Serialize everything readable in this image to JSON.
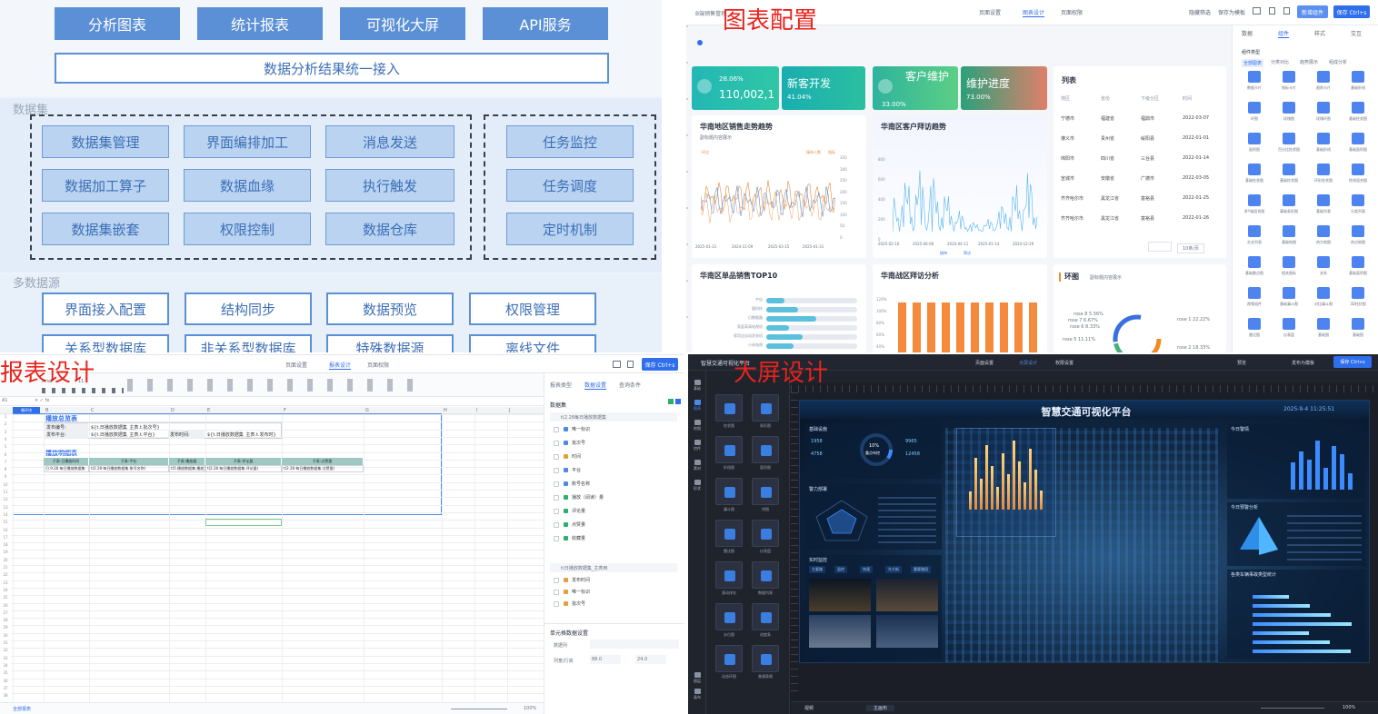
{
  "architecture": {
    "top_buttons": [
      "分析图表",
      "统计报表",
      "可视化大屏",
      "API服务"
    ],
    "unify_label": "数据分析结果统一接入",
    "dataset_section": "数据集",
    "dataset_cells": [
      [
        "数据集管理",
        "界面编排加工",
        "消息发送"
      ],
      [
        "数据加工算子",
        "数据血缘",
        "执行触发"
      ],
      [
        "数据集嵌套",
        "权限控制",
        "数据仓库"
      ]
    ],
    "task_cells": [
      "任务监控",
      "任务调度",
      "定时机制"
    ],
    "multi_source_section": "多数据源",
    "source_cells": [
      "界面接入配置",
      "结构同步",
      "数据预览",
      "权限管理"
    ],
    "source_cells_row2": [
      "关系型数据库",
      "非关系型数据库",
      "特殊数据源",
      "离线文件"
    ]
  },
  "chart_config": {
    "overlay_title": "图表配置",
    "app_name": "B端销售管理",
    "tabs": [
      "页面设置",
      "图表设计",
      "页面权限"
    ],
    "top_actions": [
      "隐藏筛选",
      "保存为模板"
    ],
    "add_component": "新增组件",
    "save": "保存 Ctrl+s",
    "kpis": [
      {
        "title": "",
        "value": "110,002,1",
        "pct": "28.06%",
        "color": "#26b8b0"
      },
      {
        "title": "新客开发",
        "value": "",
        "pct": "41.04%",
        "color": "#1fb6a9"
      },
      {
        "title": "客户维护",
        "value": "",
        "pct": "33.00%",
        "color": "#3fc08a"
      },
      {
        "title": "维护进度",
        "value": "",
        "pct": "73.00%",
        "color": "#e0806a"
      }
    ],
    "panel_titles": [
      "华南地区销售走势趋势",
      "华南区客户拜访趋势",
      "华南区单品销售TOP10",
      "华南战区拜访分析",
      "环图"
    ],
    "panel_subtitle_1": "副标题内容展示",
    "panel_subtitle_ring": "副标题内容展示",
    "trend_legend": [
      "接待人数",
      "指标"
    ],
    "trend_left_axis": "环比",
    "trend_dates": [
      "2025-01-31",
      "2024-11-09",
      "2025-03-15",
      "2025-01-31"
    ],
    "trend_yticks": [
      "350",
      "300",
      "250",
      "200",
      "150",
      "100",
      "50",
      "0"
    ],
    "visit_dates": [
      "2025-02-10",
      "2025-06-06",
      "2024-04-11",
      "2025-01-14",
      "2024-12-29"
    ],
    "visit_yticks": [
      "800",
      "600",
      "400",
      "200",
      "0"
    ],
    "visit_legend": [
      "接待",
      "拜访"
    ],
    "top10_labels": [
      "中出",
      "量科技",
      "日数据器",
      "家庭高清电视机",
      "家用全自动洗衣机",
      "小米电视"
    ],
    "visit_bar_yticks": [
      "120%",
      "100%",
      "80%",
      "60%",
      "40%"
    ],
    "ring_labels": [
      "rose 8 5.56%",
      "rose 7 6.67%",
      "rose 6 8.33%",
      "rose 5 11.11%",
      "rose 1 22.22%",
      "rose 2 18.33%"
    ],
    "list_title": "列表",
    "list_headers": [
      "地区",
      "省份",
      "下级分区",
      "时间"
    ],
    "list_rows": [
      [
        "宁德市",
        "福建省",
        "福鼎市",
        "2022-03-07"
      ],
      [
        "遵义市",
        "贵州省",
        "绥阳县",
        "2022-01-01"
      ],
      [
        "绵阳市",
        "四川省",
        "三台县",
        "2022-01-14"
      ],
      [
        "宣城市",
        "安徽省",
        "广德市",
        "2022-03-05"
      ],
      [
        "齐齐哈尔市",
        "黑龙江省",
        "富裕县",
        "2022-01-25"
      ],
      [
        "齐齐哈尔市",
        "黑龙江省",
        "富裕县",
        "2022-01-26"
      ]
    ],
    "pager": "10条/页",
    "right_tabs": [
      "数据",
      "组件",
      "样式",
      "交互"
    ],
    "component_type_label": "组件类型",
    "component_filters": [
      "全部图表",
      "分类对比",
      "趋势展示",
      "组成分析"
    ],
    "components": [
      "数据卡片",
      "指标卡片",
      "趋势卡片",
      "基础折线",
      "环图",
      "玫瑰图",
      "玫瑰环图",
      "基础柱状图",
      "面积图",
      "百分比柱状图",
      "基础折线",
      "基础面积图",
      "基础柱状图",
      "基础柱状图",
      "环形柱状图",
      "柱线混合图",
      "多Y轴混合图",
      "基础条形图",
      "基础列表",
      "分类列表",
      "交叉列表",
      "基础地图",
      "热力地图",
      "热点地图",
      "基础散点图",
      "相关图标",
      "关系",
      "基础面积图",
      "视频组件",
      "基础漏斗图",
      "对比漏斗图",
      "3D柱状图",
      "雷达图",
      "仪表盘",
      "基础图",
      "基础图"
    ]
  },
  "report_design": {
    "overlay_title": "报表设计",
    "tabs": [
      "页面设置",
      "报表设计",
      "页面权限"
    ],
    "save": "保存 Ctrl+s",
    "font": "Arial",
    "font_size": "11",
    "cell_ref": "A1",
    "columns": [
      "A",
      "B",
      "C",
      "D",
      "E",
      "F",
      "G",
      "H",
      "I",
      "J"
    ],
    "tag": "循环块",
    "summary_title": "播放总览表",
    "summary_rows": [
      [
        "发布编号:",
        "${t.日播放数据集_主表.t.批次号}"
      ],
      [
        "发布平台:",
        "${t.日播放数据集_主表.t.平台}",
        "发布时间:",
        "${t.日播放数据集_主表.t.发布时}"
      ]
    ],
    "detail_title": "播放明细表",
    "detail_headers": [
      "子表-日播放时间",
      "子表-平台",
      "子表-播放量",
      "子表-评论量",
      "子表-点赞量"
    ],
    "detail_row": [
      "日.9.28 每日播放数据集",
      "t(2.28 每日播放数据集.账号名称)",
      "t(5.播放数据集.播放)",
      "t(2.28 每日播放数据集.评论量)",
      "t(2.28 每日播放数据集.点赞量)"
    ],
    "side_tabs": [
      "报表类型",
      "数据设置",
      "查询条件"
    ],
    "dataset_label": "数据集",
    "dataset1": "t(2.28每日播放数据集",
    "dataset1_fields": [
      "唯一标识",
      "批次号",
      "时间",
      "平台",
      "账号名称",
      "播放（阅读）量",
      "评论量",
      "点赞量",
      "收藏量"
    ],
    "dataset2": "t(日播放数据集_主表用",
    "dataset2_fields": [
      "发布时间",
      "唯一标识",
      "批次号"
    ],
    "cell_settings": "单元格数据设置",
    "data_column": "数据列",
    "column_lbl": "列宽/行高",
    "col_width": "88.0",
    "row_height": "24.0",
    "sheet": "全部报表",
    "zoom": "100%"
  },
  "screen_design": {
    "overlay_title": "大屏设计",
    "app_name": "智慧交通可视化平台",
    "tabs": [
      "页面设置",
      "大屏设计",
      "权限设置"
    ],
    "top_actions": [
      "预览",
      "发布为模板"
    ],
    "save": "保存 Ctrl+s",
    "left_nav": [
      "基础",
      "图表",
      "地图",
      "控件",
      "素材",
      "形状",
      "图层",
      "画布"
    ],
    "components": [
      "柱状图",
      "条形图",
      "折线图",
      "面积图",
      "漏斗图",
      "饼图",
      "雷达图",
      "仪表盘",
      "滚动排名",
      "数据列表",
      "水位图",
      "进度条",
      "动态环图",
      "普通表格"
    ],
    "canvas_title": "智慧交通可视化平台",
    "canvas_time": "2025-9-4 11:25:51",
    "section_titles": [
      "基础设施",
      "警力部署",
      "实时监控",
      "今日警情",
      "今日预警分析",
      "各类车辆事故类型统计"
    ],
    "center_ring": "10%",
    "center_ring_label": "重点布控",
    "stats": [
      "1958",
      "4758",
      "9965",
      "12458"
    ],
    "camera_tabs": [
      "主要路",
      "监控",
      "快速",
      "东大街",
      "重要路段"
    ],
    "bottom_tabs": [
      "视频",
      "主画布"
    ],
    "zoom": "100%"
  }
}
